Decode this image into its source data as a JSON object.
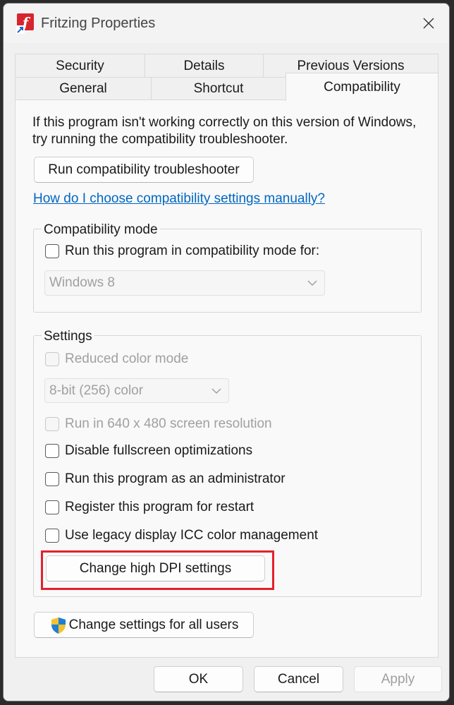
{
  "window": {
    "title": "Fritzing Properties",
    "app_icon": "fritzing-app-icon",
    "close_icon": "close-icon"
  },
  "tabs": {
    "row_back": [
      {
        "label": "Security"
      },
      {
        "label": "Details"
      },
      {
        "label": "Previous Versions"
      }
    ],
    "row_front": [
      {
        "label": "General"
      },
      {
        "label": "Shortcut"
      },
      {
        "label": "Compatibility",
        "active": true
      }
    ]
  },
  "compat": {
    "intro_line1": "If this program isn't working correctly on this version of Windows,",
    "intro_line2": "try running the compatibility troubleshooter.",
    "troubleshooter_button": "Run compatibility troubleshooter",
    "manual_link": "How do I choose compatibility settings manually?",
    "mode_group": {
      "label": "Compatibility mode",
      "checkbox_label": "Run this program in compatibility mode for:",
      "select_value": "Windows 8"
    },
    "settings_group": {
      "label": "Settings",
      "reduced_color_label": "Reduced color mode",
      "color_select_value": "8-bit (256) color",
      "res_label": "Run in 640 x 480 screen resolution",
      "fullscreen_label": "Disable fullscreen optimizations",
      "admin_label": "Run this program as an administrator",
      "restart_label": "Register this program for restart",
      "icc_label": "Use legacy display ICC color management",
      "dpi_button": "Change high DPI settings"
    },
    "all_users_button": "Change settings for all users",
    "shield_icon": "uac-shield-icon"
  },
  "footer": {
    "ok": "OK",
    "cancel": "Cancel",
    "apply": "Apply"
  },
  "colors": {
    "accent_link": "#0067c0",
    "highlight": "#e5202e"
  }
}
